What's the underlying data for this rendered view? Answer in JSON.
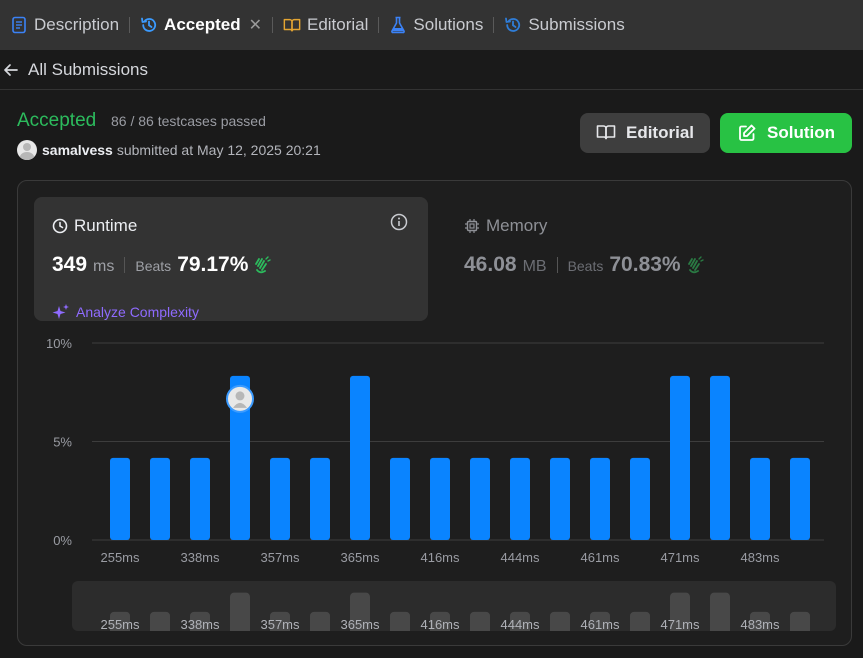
{
  "tabs": [
    {
      "label": "Description",
      "icon": "description-icon",
      "active": false
    },
    {
      "label": "Accepted",
      "icon": "history-icon",
      "active": true
    },
    {
      "label": "Editorial",
      "icon": "book-icon",
      "active": false
    },
    {
      "label": "Solutions",
      "icon": "flask-icon",
      "active": false
    },
    {
      "label": "Submissions",
      "icon": "history-icon",
      "active": false
    }
  ],
  "back_link": "All Submissions",
  "submission": {
    "status": "Accepted",
    "testcases": "86 / 86 testcases passed",
    "username": "samalvess",
    "submitted_at": "submitted at May 12, 2025 20:21"
  },
  "buttons": {
    "editorial": "Editorial",
    "solution": "Solution"
  },
  "runtime": {
    "title": "Runtime",
    "value": "349",
    "unit": "ms",
    "beats_label": "Beats",
    "beats_pct": "79.17%",
    "analyze": "Analyze Complexity"
  },
  "memory": {
    "title": "Memory",
    "value": "46.08",
    "unit": "MB",
    "beats_label": "Beats",
    "beats_pct": "70.83%"
  },
  "colors": {
    "accent_green": "#2cbb5d",
    "button_green": "#28c244",
    "bar_blue": "#0a84ff",
    "analyze_purple": "#8f6bff"
  },
  "chart_data": {
    "type": "bar",
    "y_ticks": [
      "0%",
      "5%",
      "10%"
    ],
    "ylim": [
      0,
      10
    ],
    "x_tick_labels": [
      "255ms",
      "338ms",
      "357ms",
      "365ms",
      "416ms",
      "444ms",
      "461ms",
      "471ms",
      "483ms"
    ],
    "values": [
      4.17,
      4.17,
      4.17,
      8.33,
      4.17,
      4.17,
      8.33,
      4.17,
      4.17,
      4.17,
      4.17,
      4.17,
      4.17,
      4.17,
      8.33,
      8.33,
      4.17,
      4.17
    ],
    "highlight_index": 3,
    "grid": true
  }
}
